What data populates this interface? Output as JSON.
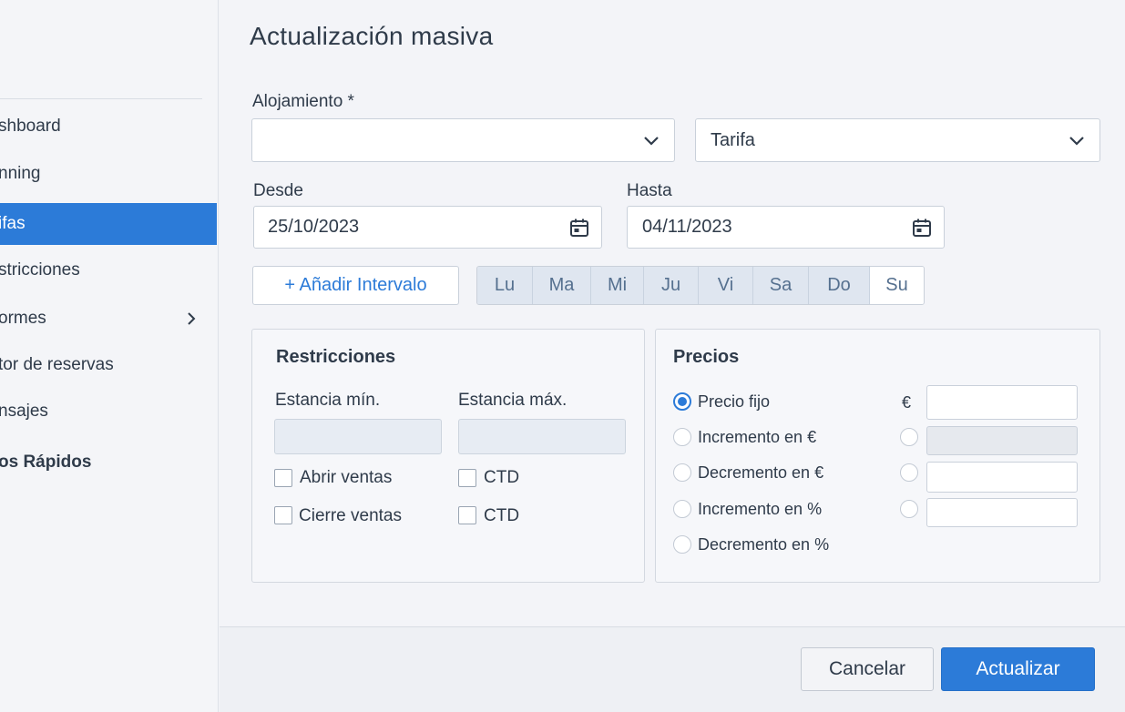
{
  "sidebar": {
    "items": [
      {
        "label": "shboard"
      },
      {
        "label": "nning"
      },
      {
        "label": "ifas"
      },
      {
        "label": "stricciones"
      },
      {
        "label": "ormes"
      },
      {
        "label": "tor de reservas"
      },
      {
        "label": "nsajes"
      },
      {
        "label": "os Rápidos"
      }
    ]
  },
  "main": {
    "title": "Actualización masiva",
    "alojamiento": {
      "label": "Alojamiento *",
      "value": ""
    },
    "tarifa": {
      "value": "Tarifa"
    },
    "desde": {
      "label": "Desde",
      "value": "25/10/2023"
    },
    "hasta": {
      "label": "Hasta",
      "value": "04/11/2023"
    },
    "add_interval_label": "+ Añadir Intervalo",
    "days": [
      "Lu",
      "Ma",
      "Mi",
      "Ju",
      "Vi",
      "Sa",
      "Do",
      "Su"
    ]
  },
  "restricciones": {
    "title": "Restricciones",
    "min_label": "Estancia mín.",
    "max_label": "Estancia máx.",
    "checks": [
      {
        "label": "Abrir ventas"
      },
      {
        "label": "CTD"
      },
      {
        "label": "Cierre ventas"
      },
      {
        "label": "CTD"
      }
    ]
  },
  "precios": {
    "title": "Precios",
    "currency": "€",
    "options": [
      {
        "label": "Precio fijo",
        "selected": true
      },
      {
        "label": "Incremento en €",
        "selected": false
      },
      {
        "label": "Decremento en €",
        "selected": false
      },
      {
        "label": "Incremento en %",
        "selected": false
      },
      {
        "label": "Decremento en %",
        "selected": false
      }
    ]
  },
  "footer": {
    "cancel_label": "Cancelar",
    "update_label": "Actualizar"
  },
  "colors": {
    "accent": "#2c7bd8"
  }
}
